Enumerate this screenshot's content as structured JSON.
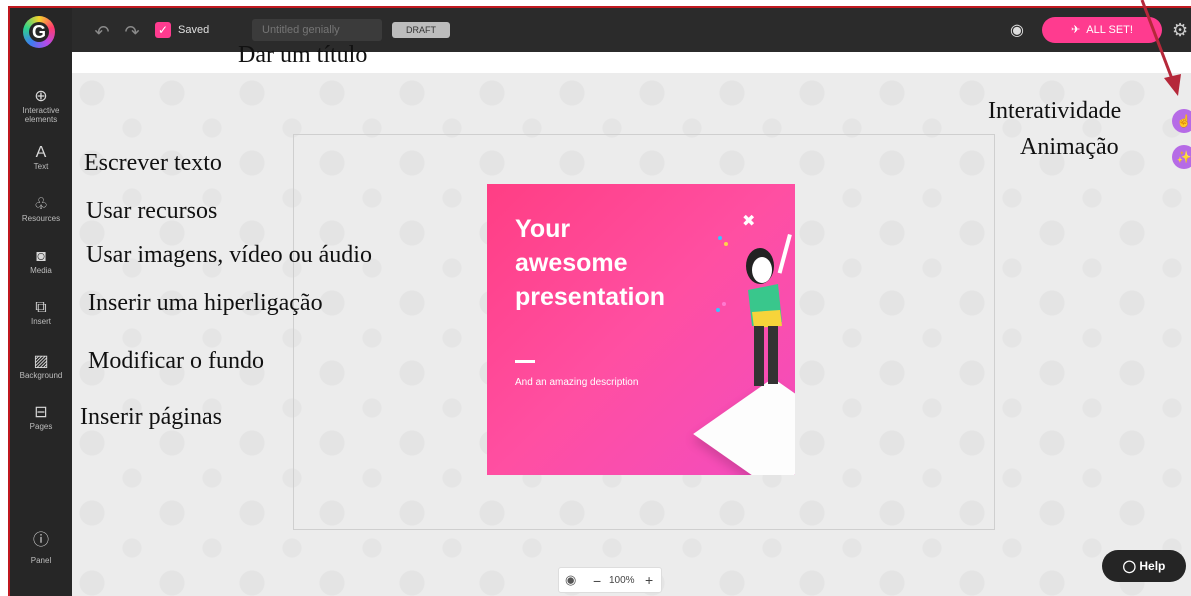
{
  "topbar": {
    "logo": "G",
    "undo_icon": "undo-icon",
    "redo_icon": "redo-icon",
    "saved_label": "Saved",
    "title_placeholder": "Untitled genially",
    "draft_label": "DRAFT",
    "preview_icon": "eye-icon",
    "allset_label": "ALL SET!",
    "settings_icon": "gear-icon"
  },
  "sidebar": {
    "items": [
      {
        "icon": "⊕",
        "label": "Interactive elements"
      },
      {
        "icon": "A",
        "label": "Text"
      },
      {
        "icon": "♧",
        "label": "Resources"
      },
      {
        "icon": "◙",
        "label": "Media"
      },
      {
        "icon": "⧉",
        "label": "Insert"
      },
      {
        "icon": "▨",
        "label": "Background"
      },
      {
        "icon": "⊟",
        "label": "Pages"
      },
      {
        "icon": "ⓘ",
        "label": "Panel"
      }
    ]
  },
  "slide": {
    "title": "Your\nawesome\npresentation",
    "description": "And an amazing description"
  },
  "zoom": {
    "minus": "−",
    "value": "100%",
    "plus": "+"
  },
  "help_label": "Help",
  "annotations": {
    "title": "Dar um título",
    "text": "Escrever texto",
    "resources": "Usar recursos",
    "media": "Usar imagens, vídeo ou áudio",
    "insert": "Inserir uma hiperligação",
    "background": "Modificar o fundo",
    "pages": "Inserir páginas",
    "interactivity": "Interatividade",
    "animation": "Animação"
  },
  "colors": {
    "accent": "#ff3b8f",
    "arrow": "#b5283a",
    "action_purple": "#b66be6"
  }
}
